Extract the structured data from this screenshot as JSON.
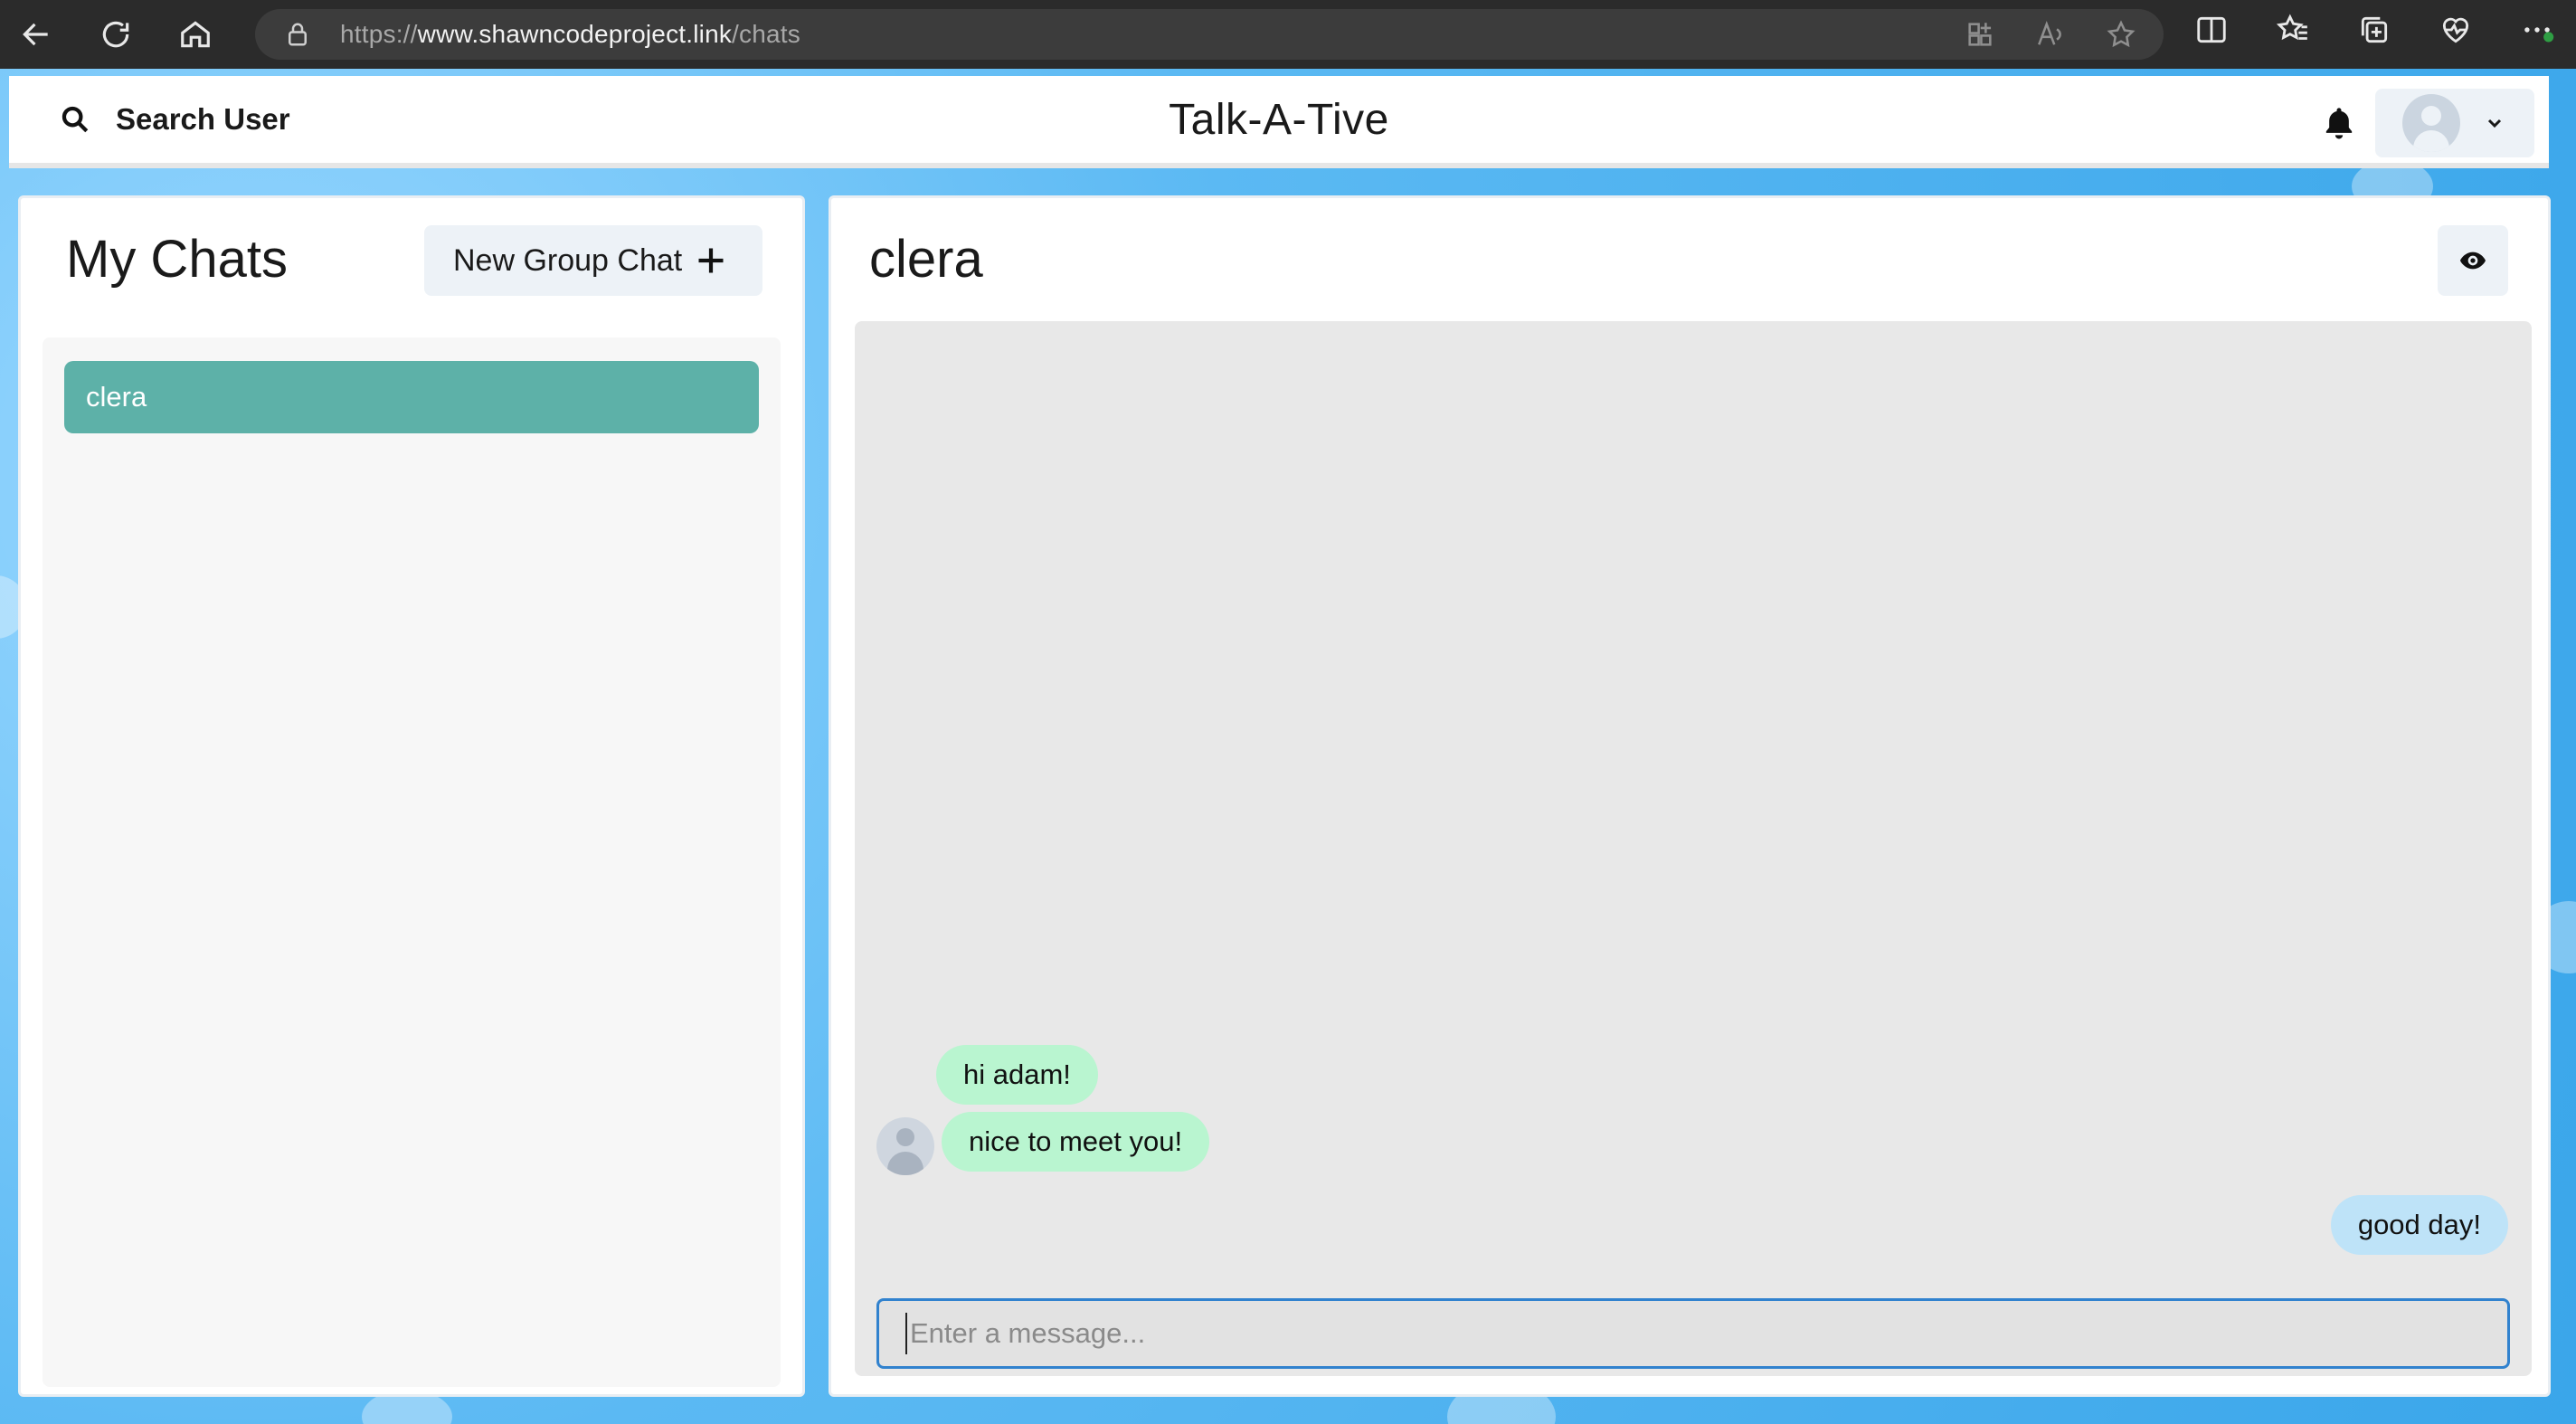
{
  "browser": {
    "url_prefix": "https://",
    "url_host": "www.shawncodeproject.link",
    "url_path": "/chats"
  },
  "header": {
    "search_label": "Search User",
    "app_title": "Talk-A-Tive"
  },
  "sidebar": {
    "title": "My Chats",
    "new_group_label": "New Group Chat",
    "chats": [
      {
        "name": "clera",
        "selected": true
      }
    ]
  },
  "chat": {
    "title": "clera",
    "messages": [
      {
        "text": "hi adam!",
        "direction": "incoming"
      },
      {
        "text": "nice to meet you!",
        "direction": "incoming"
      },
      {
        "text": "good day!",
        "direction": "outgoing"
      }
    ],
    "input_placeholder": "Enter a message..."
  },
  "colors": {
    "selected_chat": "#5db1a8",
    "incoming_bubble": "#b9f5d0",
    "outgoing_bubble": "#bee3f8",
    "input_focus_border": "#3182ce",
    "page_background": "#5bb9f3"
  },
  "icons": {
    "back": "back-arrow-icon",
    "refresh": "refresh-icon",
    "home": "home-icon",
    "lock": "lock-icon",
    "search": "search-icon",
    "bell": "bell-icon",
    "avatar": "avatar-icon",
    "chevron": "chevron-down-icon",
    "plus": "plus-icon",
    "eye": "eye-icon"
  }
}
